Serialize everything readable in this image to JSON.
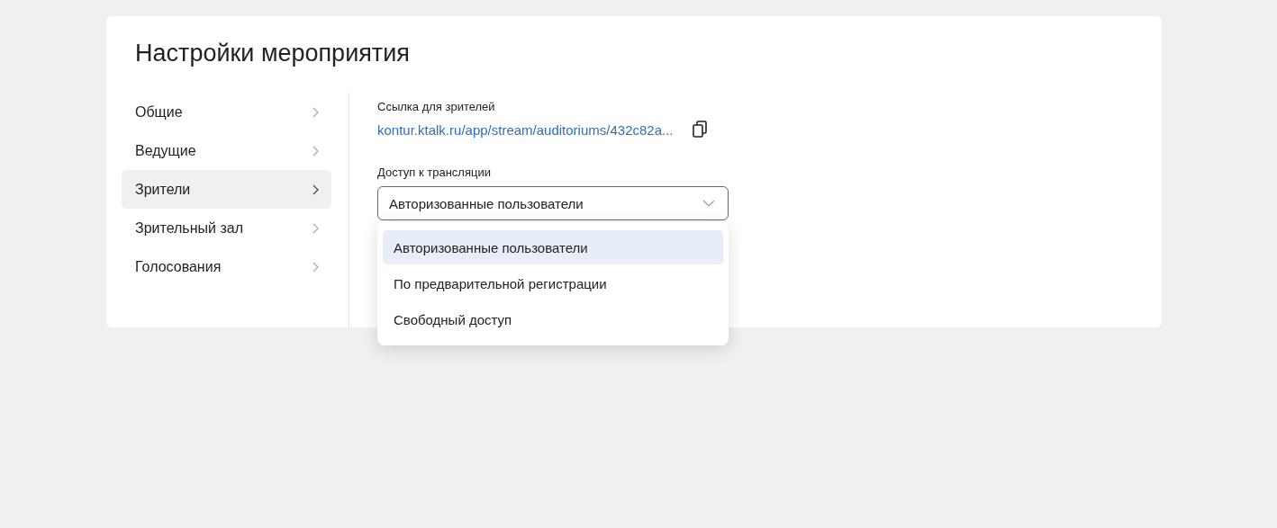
{
  "title": "Настройки мероприятия",
  "sidebar": {
    "items": [
      {
        "label": "Общие",
        "selected": false
      },
      {
        "label": "Ведущие",
        "selected": false
      },
      {
        "label": "Зрители",
        "selected": true
      },
      {
        "label": "Зрительный зал",
        "selected": false
      },
      {
        "label": "Голосования",
        "selected": false
      }
    ]
  },
  "viewer_link": {
    "label": "Ссылка для зрителей",
    "url": "kontur.ktalk.ru/app/stream/auditoriums/432c82a..."
  },
  "access": {
    "label": "Доступ к трансляции",
    "value": "Авторизованные пользователи",
    "expanded": true,
    "options": [
      {
        "label": "Авторизованные пользователи",
        "selected": true
      },
      {
        "label": "По предварительной регистрации",
        "selected": false
      },
      {
        "label": "Свободный доступ",
        "selected": false
      }
    ]
  }
}
